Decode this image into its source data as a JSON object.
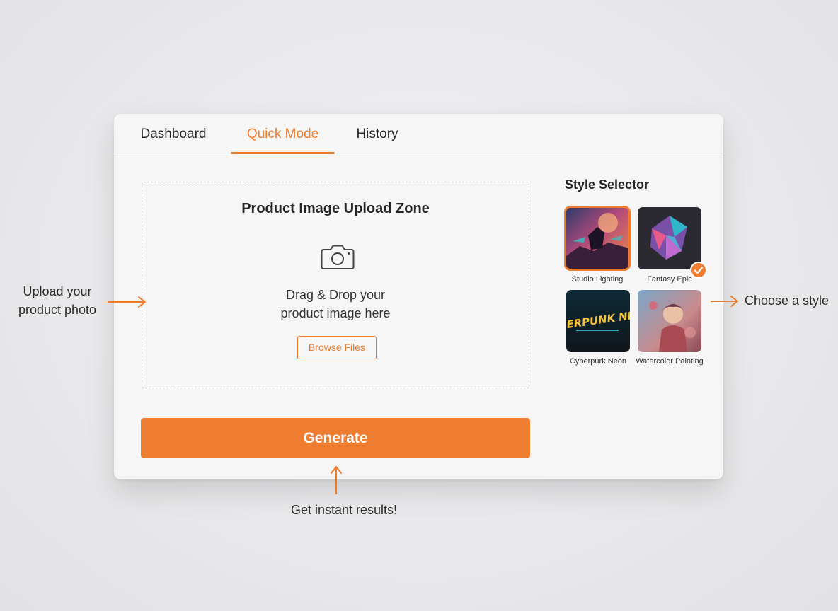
{
  "tabs": [
    "Dashboard",
    "Quick Mode",
    "History"
  ],
  "active_tab": "Quick Mode",
  "accent_color": "#ec7b2c",
  "upload": {
    "title": "Product Image Upload Zone",
    "icon": "camera-icon",
    "drag_line1": "Drag & Drop your",
    "drag_line2": "product image here",
    "browse_label": "Browse Files"
  },
  "generate_label": "Generate",
  "style_selector": {
    "title": "Style Selector",
    "styles": [
      {
        "label": "Studio Lighting"
      },
      {
        "label": "Fantasy Epic"
      },
      {
        "label": "Cyberpurk Neon"
      },
      {
        "label": "Watercolor Painting"
      }
    ],
    "highlighted": "Studio Lighting",
    "checked": "Fantasy Epic",
    "check_icon": "checkmark-icon",
    "thumb2_text": "CYBERPUNK NEON"
  },
  "annotations": {
    "upload_line1": "Upload your",
    "upload_line2": "product photo",
    "style": "Choose a style",
    "results": "Get instant results!"
  }
}
